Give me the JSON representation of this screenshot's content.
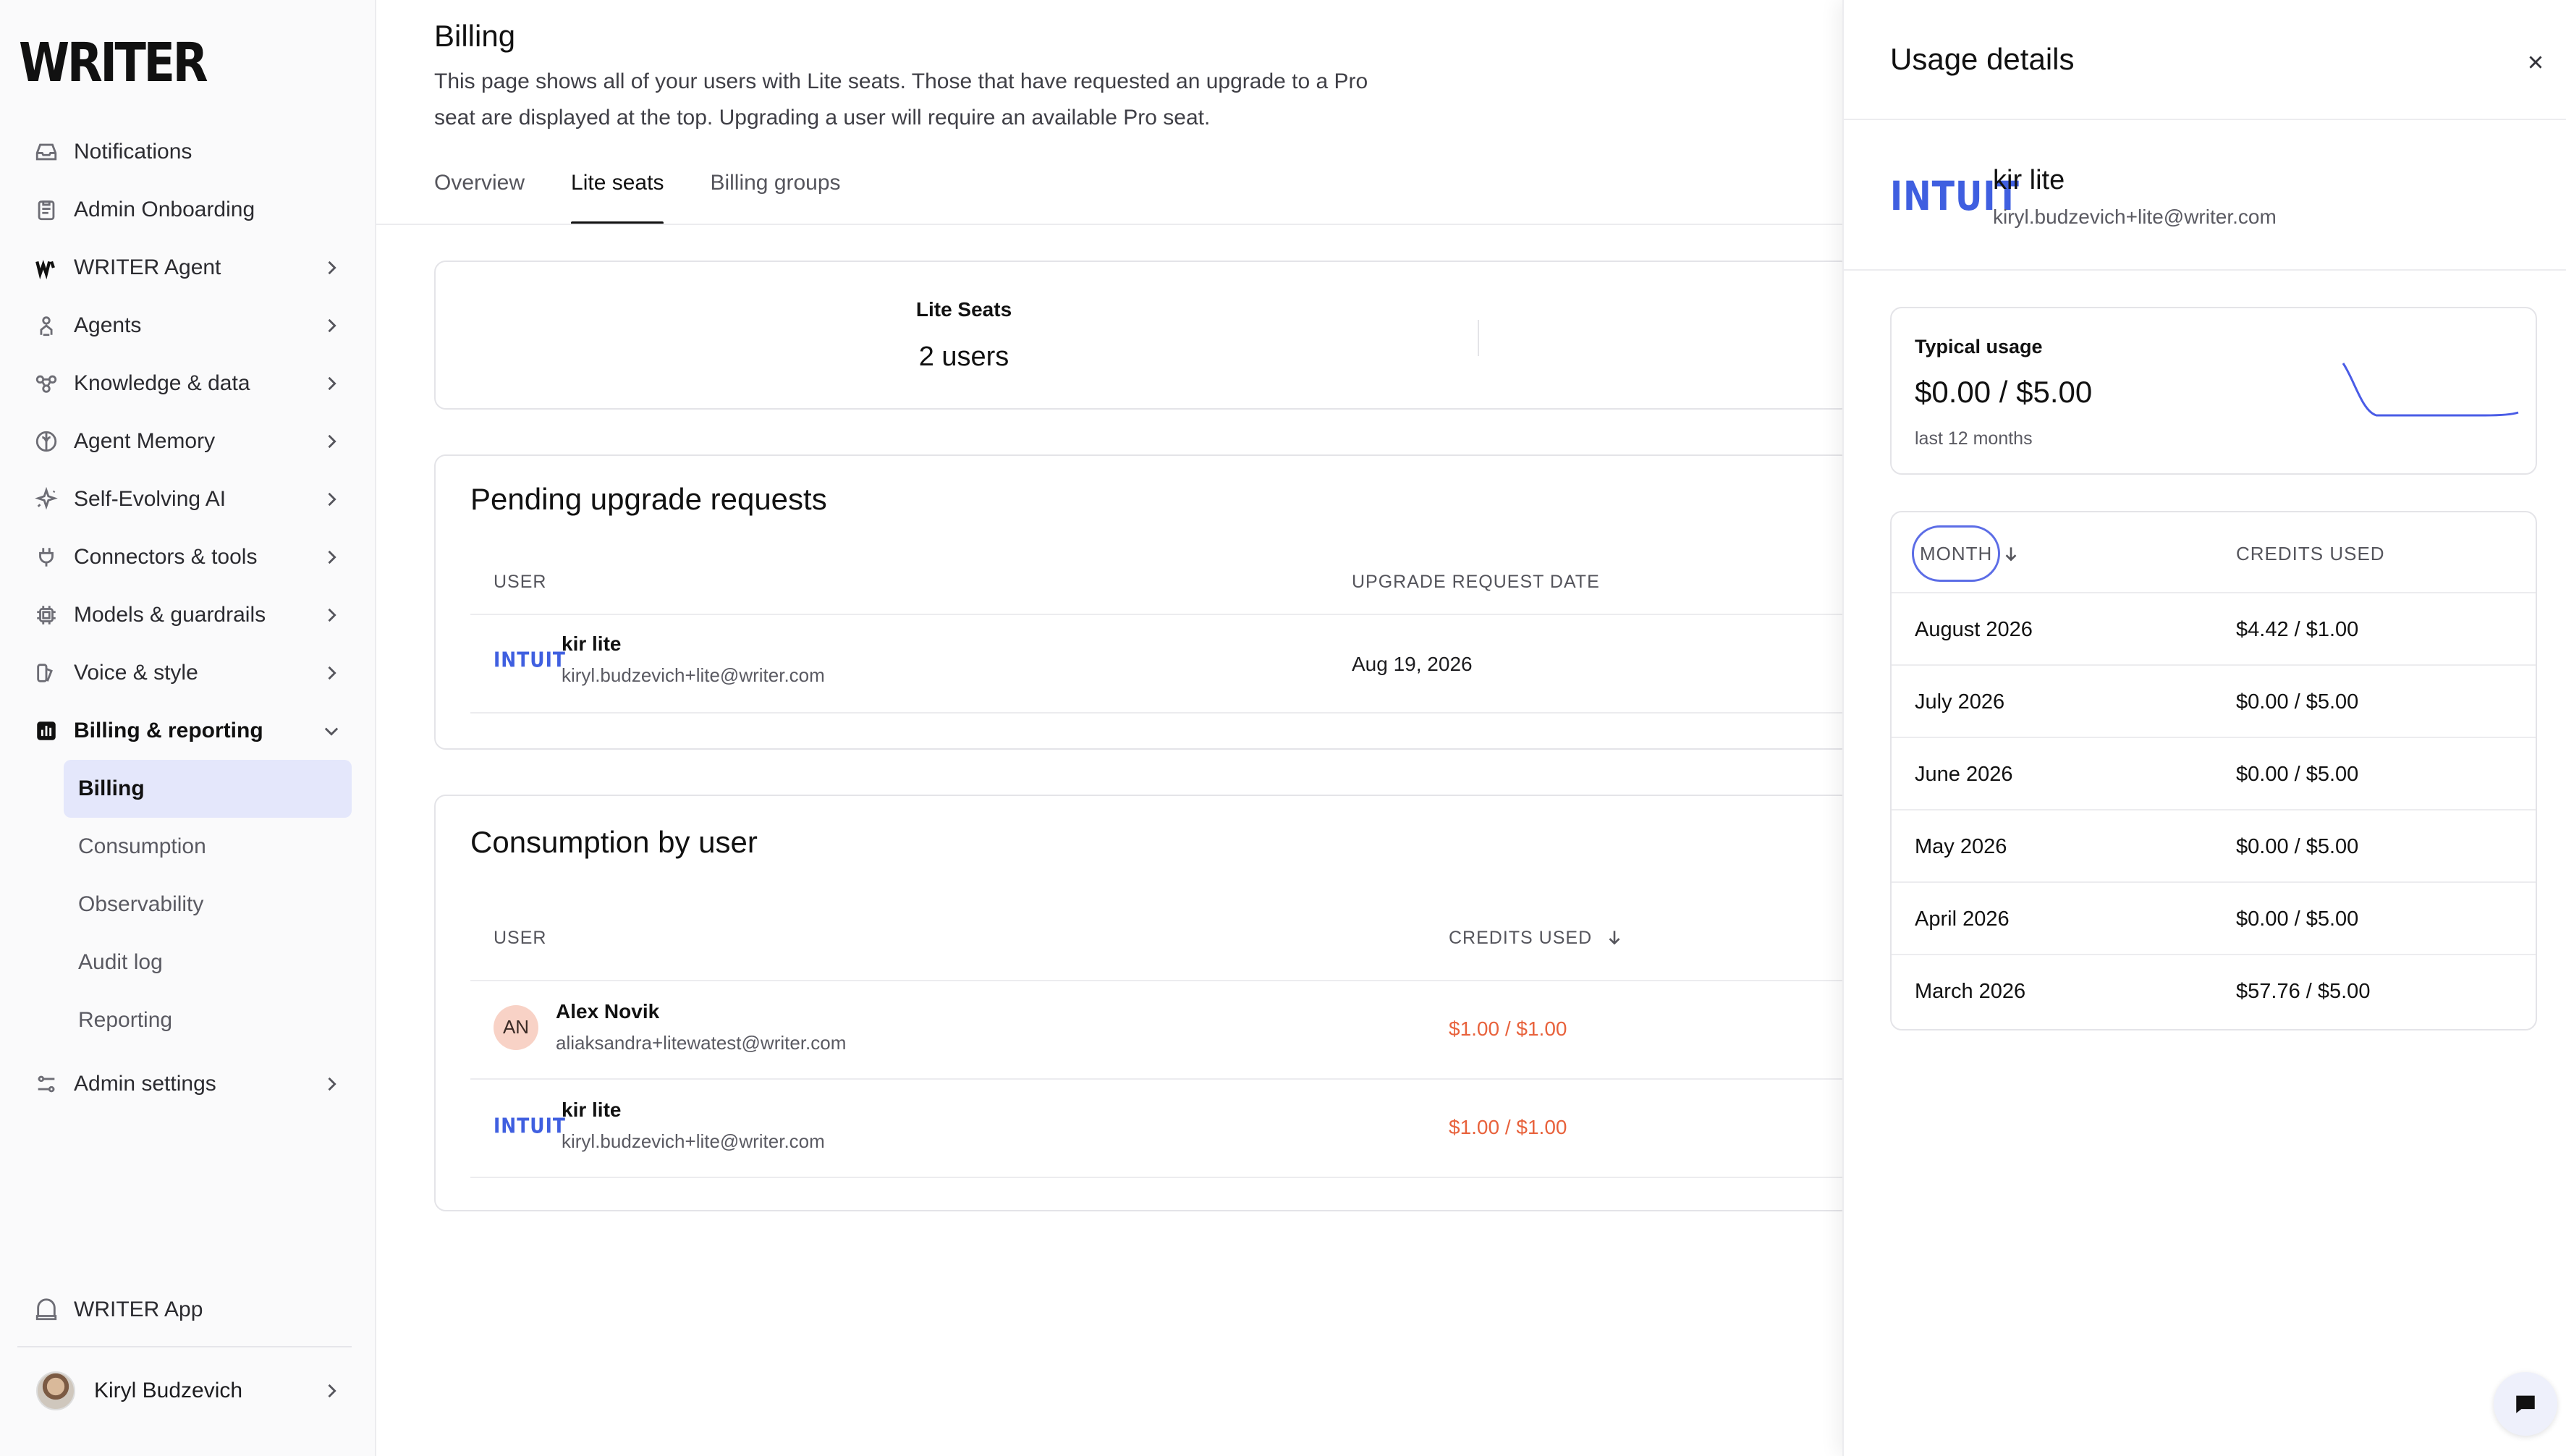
{
  "brand": {
    "logo_text": "WRITER",
    "accent": "#3f5fe0",
    "active_bg": "#e4e7fb",
    "warning_text": "#e8623c"
  },
  "sidebar": {
    "items": [
      {
        "label": "Notifications",
        "icon": "inbox-icon",
        "has_chevron": false
      },
      {
        "label": "Admin Onboarding",
        "icon": "clipboard-icon",
        "has_chevron": false
      },
      {
        "label": "WRITER Agent",
        "icon": "writer-logo-icon",
        "has_chevron": true
      },
      {
        "label": "Agents",
        "icon": "agent-icon",
        "has_chevron": true
      },
      {
        "label": "Knowledge & data",
        "icon": "network-icon",
        "has_chevron": true
      },
      {
        "label": "Agent Memory",
        "icon": "brain-icon",
        "has_chevron": true
      },
      {
        "label": "Self-Evolving AI",
        "icon": "sparkle-icon",
        "has_chevron": true
      },
      {
        "label": "Connectors & tools",
        "icon": "plug-icon",
        "has_chevron": true
      },
      {
        "label": "Models & guardrails",
        "icon": "chip-icon",
        "has_chevron": true
      },
      {
        "label": "Voice & style",
        "icon": "palette-icon",
        "has_chevron": true
      },
      {
        "label": "Billing & reporting",
        "icon": "bar-chart-icon",
        "has_chevron": true,
        "expanded": true
      }
    ],
    "sub_items": [
      {
        "label": "Billing",
        "active": true
      },
      {
        "label": "Consumption"
      },
      {
        "label": "Observability"
      },
      {
        "label": "Audit log"
      },
      {
        "label": "Reporting"
      }
    ],
    "admin_settings": "Admin settings",
    "writer_app": "WRITER App",
    "user_name": "Kiryl Budzevich"
  },
  "main": {
    "title": "Billing",
    "description": "This page shows all of your users with Lite seats. Those that have requested an upgrade to a Pro seat are displayed at the top. Upgrading a user will require an available Pro seat.",
    "tabs": [
      {
        "label": "Overview",
        "active": false
      },
      {
        "label": "Lite seats",
        "active": true
      },
      {
        "label": "Billing groups",
        "active": false
      }
    ],
    "stats": {
      "label": "Lite Seats",
      "value": "2 users"
    },
    "pending": {
      "title": "Pending upgrade requests",
      "col_user": "USER",
      "col_date": "UPGRADE REQUEST DATE",
      "rows": [
        {
          "logo": "INTUIT",
          "name": "kir lite",
          "email": "kiryl.budzevich+lite@writer.com",
          "date": "Aug 19, 2026"
        }
      ]
    },
    "consumption": {
      "title": "Consumption by user",
      "col_user": "USER",
      "col_credits": "CREDITS USED",
      "rows": [
        {
          "avatar": "AN",
          "name": "Alex Novik",
          "email": "aliaksandra+litewatest@writer.com",
          "credits": "$1.00 / $1.00"
        },
        {
          "logo": "INTUIT",
          "name": "kir lite",
          "email": "kiryl.budzevich+lite@writer.com",
          "credits": "$1.00 / $1.00"
        }
      ]
    }
  },
  "drawer": {
    "title": "Usage details",
    "user": {
      "logo": "INTUIT",
      "name": "kir lite",
      "email": "kiryl.budzevich+lite@writer.com"
    },
    "typical_usage": {
      "label": "Typical usage",
      "value": "$0.00 / $5.00",
      "period": "last 12 months"
    },
    "table": {
      "col_month": "MONTH",
      "col_credits": "CREDITS USED",
      "rows": [
        {
          "month": "August 2026",
          "credits": "$4.42 / $1.00"
        },
        {
          "month": "July 2026",
          "credits": "$0.00 / $5.00"
        },
        {
          "month": "June 2026",
          "credits": "$0.00 / $5.00"
        },
        {
          "month": "May 2026",
          "credits": "$0.00 / $5.00"
        },
        {
          "month": "April 2026",
          "credits": "$0.00 / $5.00"
        },
        {
          "month": "March 2026",
          "credits": "$57.76 / $5.00"
        }
      ]
    }
  }
}
